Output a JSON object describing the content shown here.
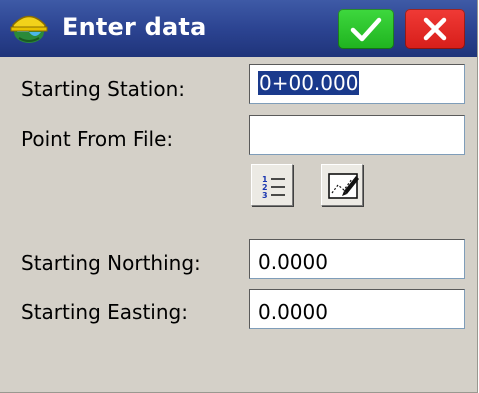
{
  "window": {
    "title": "Enter data"
  },
  "form": {
    "starting_station": {
      "label": "Starting Station:",
      "value": "0+00.000"
    },
    "point_from_file": {
      "label": "Point From File:",
      "value": ""
    },
    "starting_northing": {
      "label": "Starting Northing:",
      "value": "0.0000"
    },
    "starting_easting": {
      "label": "Starting Easting:",
      "value": "0.0000"
    }
  },
  "icons": {
    "app": "hardhat-globe-icon",
    "ok": "checkmark-icon",
    "cancel": "close-icon",
    "list": "numbered-list-icon",
    "map": "map-pick-icon"
  },
  "colors": {
    "titlebar": "#2c4492",
    "ok_button": "#2ec72e",
    "cancel_button": "#e02a26",
    "selection": "#1a3a8c"
  }
}
